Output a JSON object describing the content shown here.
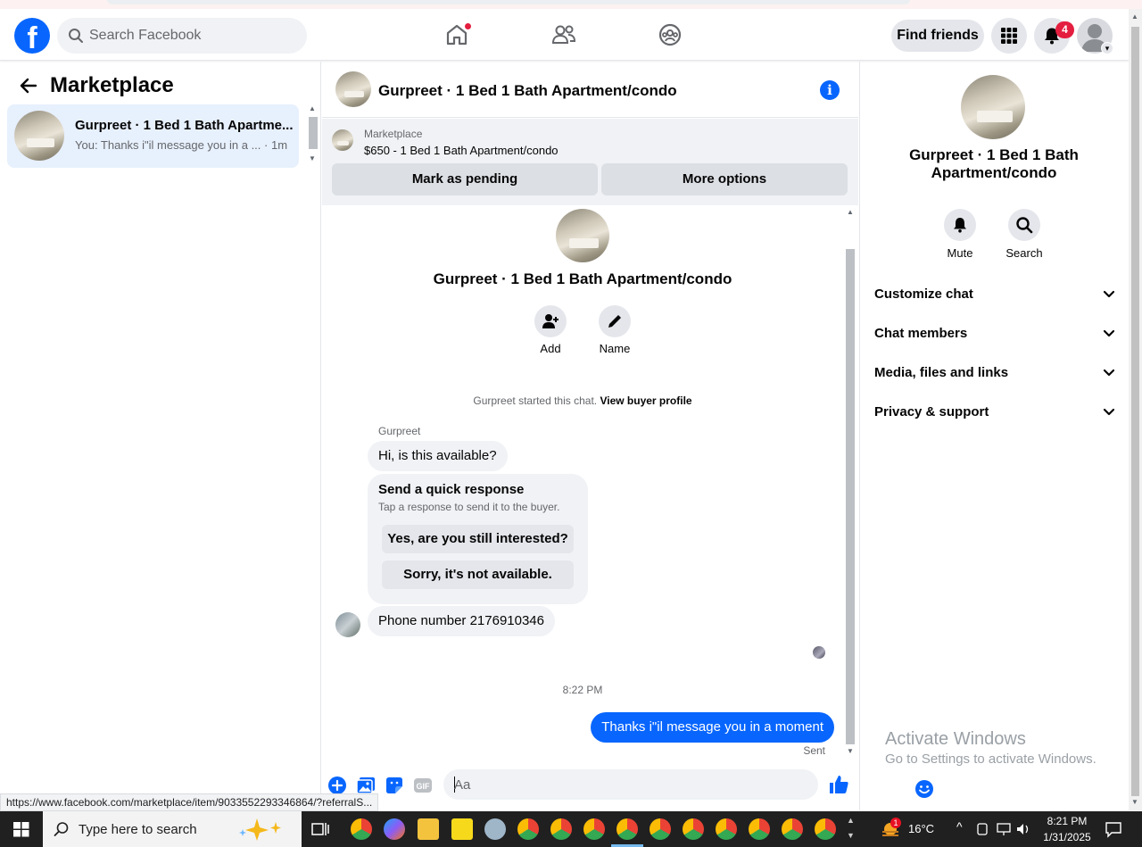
{
  "navbar": {
    "logo": "f",
    "search_placeholder": "Search Facebook",
    "find_friends": "Find friends",
    "notifications_count": "4"
  },
  "sidebar": {
    "title": "Marketplace",
    "conversations": [
      {
        "title": "Gurpreet · 1 Bed 1 Bath Apartme...",
        "preview": "You: Thanks i\"il message you in a ...",
        "time": "· 1m"
      }
    ]
  },
  "chat": {
    "header_title": "Gurpreet · 1 Bed 1 Bath Apartment/condo",
    "marketplace_label": "Marketplace",
    "listing": "$650 - 1 Bed 1 Bath Apartment/condo",
    "mark_pending": "Mark as pending",
    "more_options": "More options",
    "intro_title": "Gurpreet · 1 Bed 1 Bath Apartment/condo",
    "intro_actions": {
      "add": "Add",
      "name": "Name"
    },
    "started_text": "Gurpreet started this chat.",
    "view_buyer_profile": "View buyer profile",
    "sender_name": "Gurpreet",
    "messages": {
      "first": "Hi, is this available?",
      "phone": "Phone number 2176910346",
      "outgoing": "Thanks i\"il message you in a moment"
    },
    "quick_response": {
      "title": "Send a quick response",
      "subtitle": "Tap a response to send it to the buyer.",
      "options": [
        "Yes, are you still interested?",
        "Sorry, it's not available."
      ]
    },
    "timestamp": "8:22 PM",
    "sent_label": "Sent",
    "composer_placeholder": "Aa",
    "gif_label": "GIF"
  },
  "details": {
    "title": "Gurpreet · 1 Bed 1 Bath Apartment/condo",
    "actions": {
      "mute": "Mute",
      "search": "Search"
    },
    "sections": [
      "Customize chat",
      "Chat members",
      "Media, files and links",
      "Privacy & support"
    ]
  },
  "watermark": {
    "line1": "Activate Windows",
    "line2": "Go to Settings to activate Windows."
  },
  "status_url": "https://www.facebook.com/marketplace/item/903355229334686​4/?referralS...",
  "taskbar": {
    "search_placeholder": "Type here to search",
    "weather_temp": "16°C",
    "weather_badge": "1",
    "time": "8:21 PM",
    "date": "1/31/2025"
  },
  "colors": {
    "brand": "#0866ff",
    "selected_conversation": "#e7f0fd",
    "badge": "#e41e3f"
  }
}
